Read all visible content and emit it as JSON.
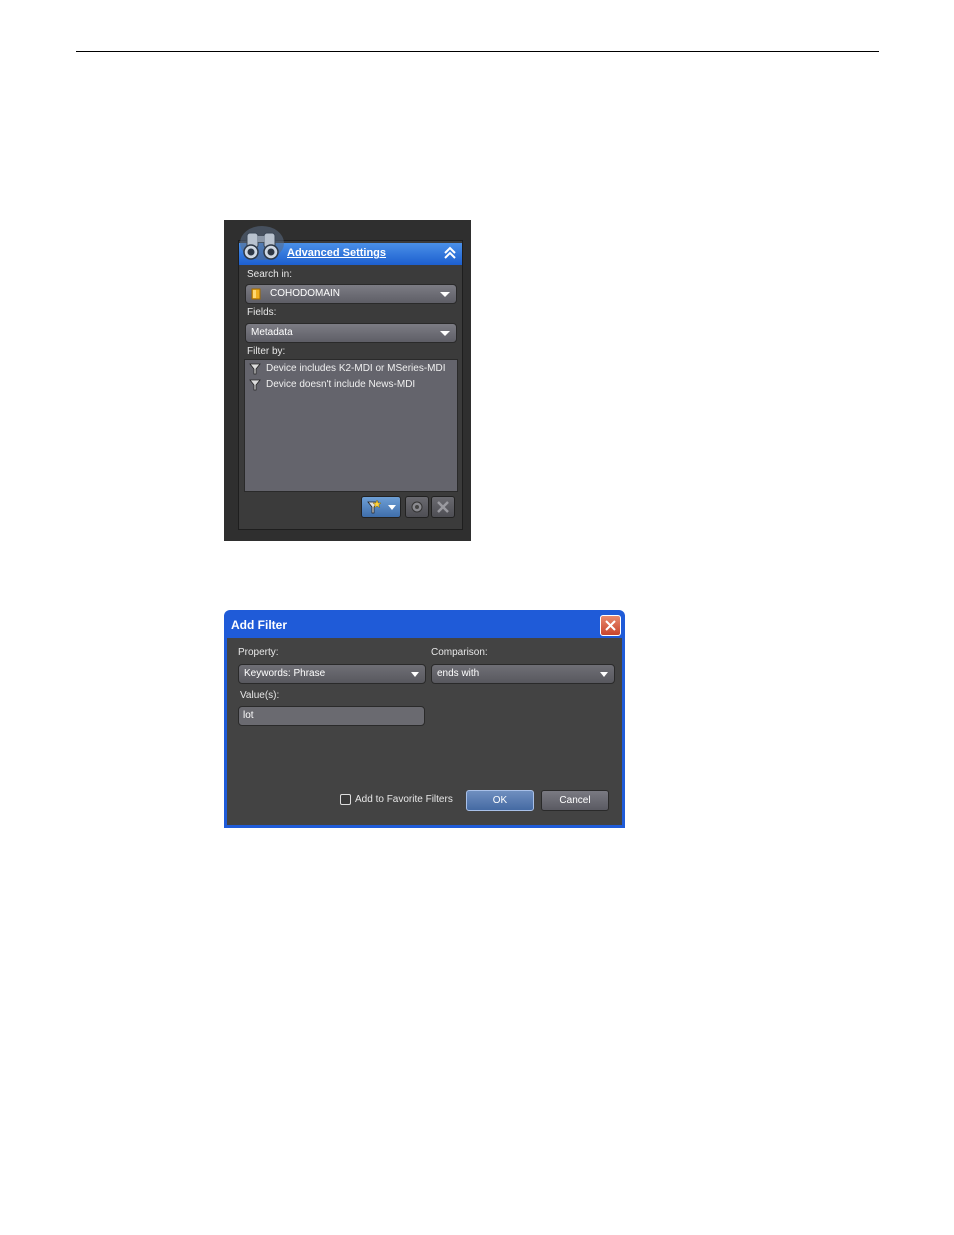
{
  "advanced_panel": {
    "title": "Advanced Settings",
    "search_in_label": "Search in:",
    "search_in_value": "COHODOMAIN",
    "fields_label": "Fields:",
    "fields_value": "Metadata",
    "filter_by_label": "Filter by:",
    "filters": [
      "Device includes K2-MDI or MSeries-MDI",
      "Device doesn't include News-MDI"
    ],
    "icons": {
      "header": "binoculars-icon",
      "collapse": "chevron-up-double-icon",
      "folder": "folder-icon",
      "filter": "funnel-icon",
      "add_filter": "add-filter-icon",
      "edit_filter": "gear-icon",
      "delete_filter": "delete-icon"
    }
  },
  "add_filter_dialog": {
    "title": "Add Filter",
    "property_label": "Property:",
    "property_value": "Keywords: Phrase",
    "comparison_label": "Comparison:",
    "comparison_value": "ends with",
    "values_label": "Value(s):",
    "values_value": "lot",
    "favorite_label": "Add to Favorite Filters",
    "favorite_checked": false,
    "ok_label": "OK",
    "cancel_label": "Cancel"
  },
  "colors": {
    "title_bar": "#1f5bd8",
    "panel_header": "#2b6fdc",
    "dark_bg": "#434343"
  }
}
